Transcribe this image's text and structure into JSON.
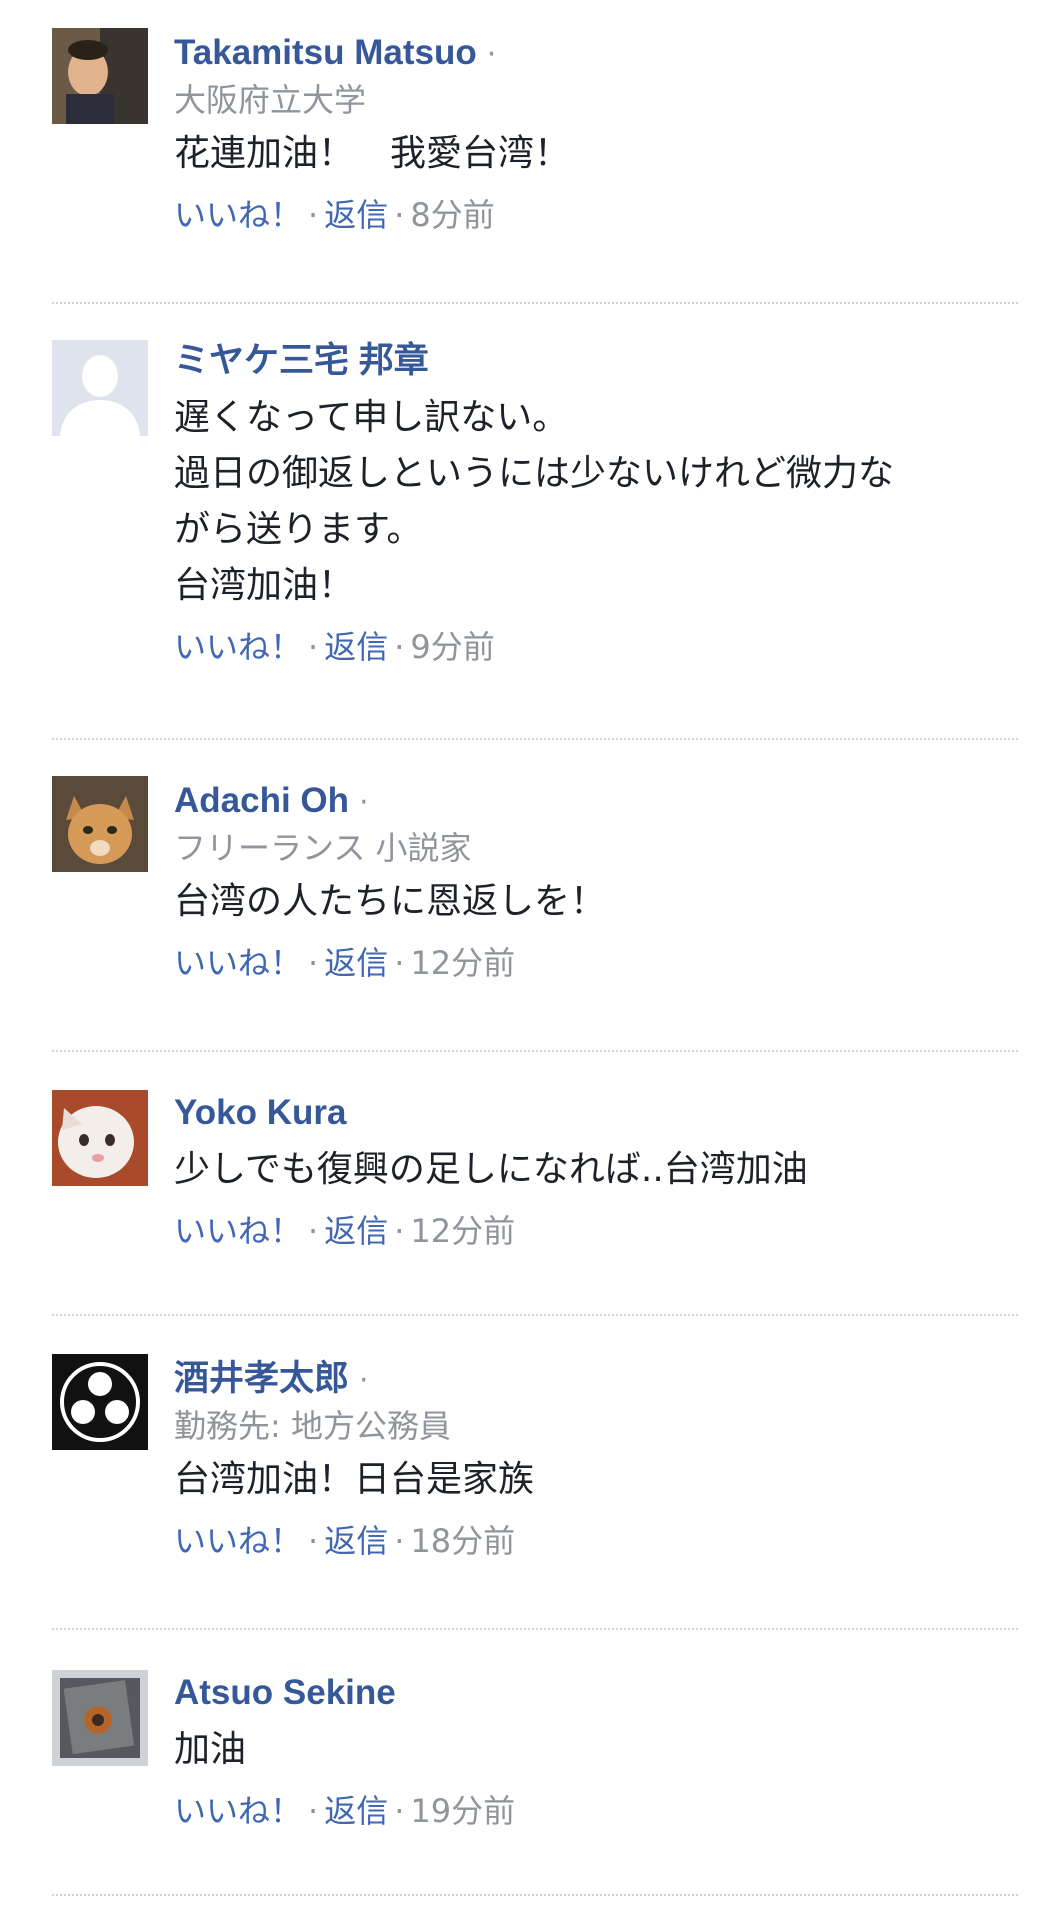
{
  "comments": [
    {
      "name": "Takamitsu Matsuo",
      "show_dot": true,
      "subtitle": "大阪府立大学",
      "lines": [
        "花連加油！　我愛台湾！"
      ],
      "like": "いいね！",
      "reply": "返信",
      "sep": "·",
      "time": "8分前",
      "avatar": "photo-person"
    },
    {
      "name": "ミヤケ三宅 邦章",
      "show_dot": false,
      "subtitle": "",
      "lines": [
        "遅くなって申し訳ない。",
        "過日の御返しというには少ないけれど微力な",
        "がら送ります。",
        "台湾加油！"
      ],
      "like": "いいね！",
      "reply": "返信",
      "sep": "·",
      "time": "9分前",
      "avatar": "default-silhouette"
    },
    {
      "name": "Adachi Oh",
      "show_dot": true,
      "subtitle": "フリーランス 小説家",
      "lines": [
        "台湾の人たちに恩返しを！"
      ],
      "like": "いいね！",
      "reply": "返信",
      "sep": "·",
      "time": "12分前",
      "avatar": "photo-cat"
    },
    {
      "name": "Yoko Kura",
      "show_dot": false,
      "subtitle": "",
      "lines": [
        "少しでも復興の足しになれば..台湾加油"
      ],
      "like": "いいね！",
      "reply": "返信",
      "sep": "·",
      "time": "12分前",
      "avatar": "photo-white-cat"
    },
    {
      "name": "酒井孝太郎",
      "show_dot": true,
      "subtitle": "勤務先: 地方公務員",
      "lines": [
        "台湾加油！日台是家族"
      ],
      "like": "いいね！",
      "reply": "返信",
      "sep": "·",
      "time": "18分前",
      "avatar": "family-crest"
    },
    {
      "name": "Atsuo Sekine",
      "show_dot": false,
      "subtitle": "",
      "lines": [
        "加油"
      ],
      "like": "いいね！",
      "reply": "返信",
      "sep": "·",
      "time": "19分前",
      "avatar": "photo-object"
    }
  ],
  "colors": {
    "name": "#365899",
    "link": "#4267b2",
    "meta": "#90949c",
    "text": "#1d2129",
    "divider": "#d0d3d9"
  }
}
